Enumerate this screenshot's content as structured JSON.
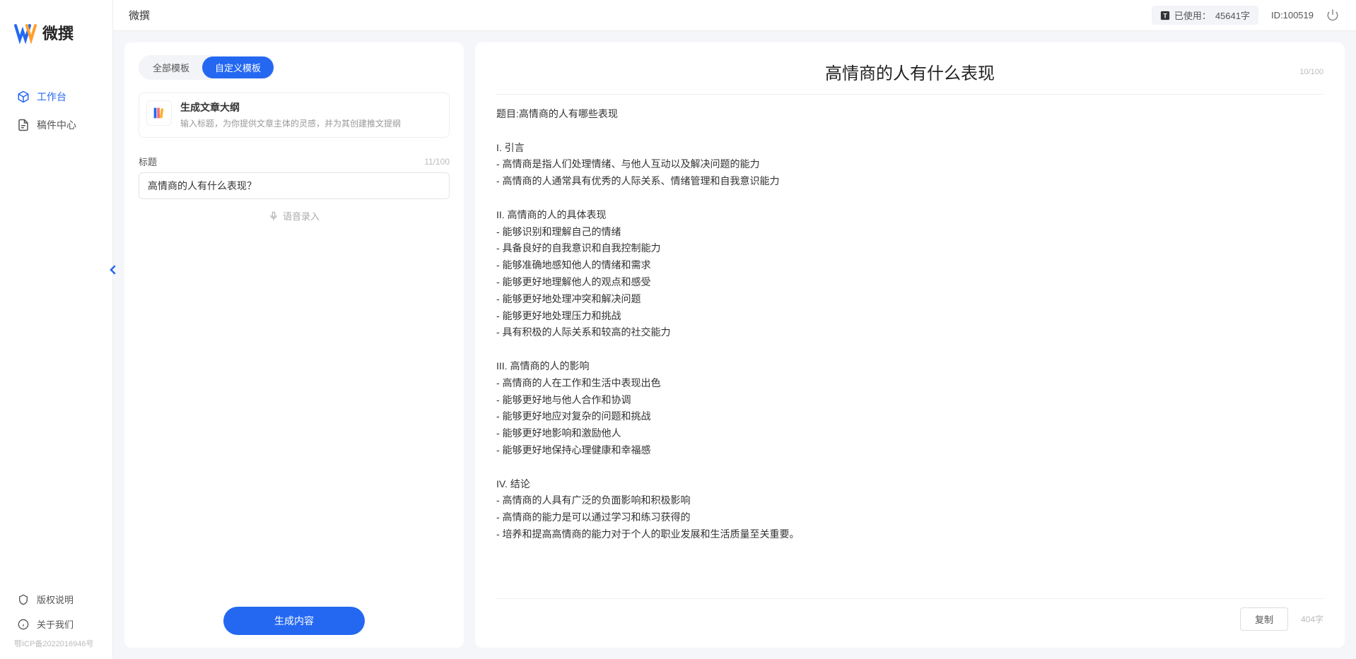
{
  "sidebar": {
    "logo_text": "微撰",
    "nav": [
      {
        "label": "工作台",
        "active": true
      },
      {
        "label": "稿件中心",
        "active": false
      }
    ],
    "bottom": [
      {
        "label": "版权说明"
      },
      {
        "label": "关于我们"
      }
    ],
    "icp": "鄂ICP备2022016946号"
  },
  "topbar": {
    "title": "微撰",
    "usage_label": "已使用：",
    "usage_value": "45641字",
    "id_label": "ID:",
    "id_value": "100519"
  },
  "left": {
    "tabs": [
      {
        "label": "全部模板",
        "active": false
      },
      {
        "label": "自定义模板",
        "active": true
      }
    ],
    "template": {
      "title": "生成文章大纲",
      "desc": "输入标题，为你提供文章主体的灵感，并为其创建推文提纲"
    },
    "form": {
      "label": "标题",
      "count": "11/100",
      "value": "高情商的人有什么表现？"
    },
    "voice_label": "语音录入",
    "generate_label": "生成内容"
  },
  "right": {
    "title": "高情商的人有什么表现",
    "title_count": "10/100",
    "body": "题目:高情商的人有哪些表现\n\nI. 引言\n- 高情商是指人们处理情绪、与他人互动以及解决问题的能力\n- 高情商的人通常具有优秀的人际关系、情绪管理和自我意识能力\n\nII. 高情商的人的具体表现\n- 能够识别和理解自己的情绪\n- 具备良好的自我意识和自我控制能力\n- 能够准确地感知他人的情绪和需求\n- 能够更好地理解他人的观点和感受\n- 能够更好地处理冲突和解决问题\n- 能够更好地处理压力和挑战\n- 具有积极的人际关系和较高的社交能力\n\nIII. 高情商的人的影响\n- 高情商的人在工作和生活中表现出色\n- 能够更好地与他人合作和协调\n- 能够更好地应对复杂的问题和挑战\n- 能够更好地影响和激励他人\n- 能够更好地保持心理健康和幸福感\n\nIV. 结论\n- 高情商的人具有广泛的负面影响和积极影响\n- 高情商的能力是可以通过学习和练习获得的\n- 培养和提高高情商的能力对于个人的职业发展和生活质量至关重要。",
    "copy_label": "复制",
    "char_count": "404字"
  }
}
